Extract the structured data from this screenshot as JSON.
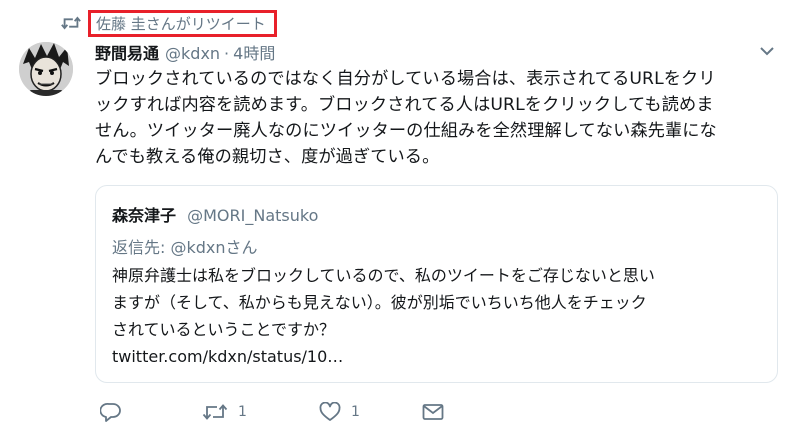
{
  "retweet": {
    "icon": "retweet-icon",
    "label": "佐藤 圭さんがリツイート",
    "highlight_color": "#e8202a"
  },
  "tweet": {
    "avatar": "avatar",
    "name": "野間易通",
    "handle": "@kdxn",
    "separator": "·",
    "time": "4時間",
    "lines": [
      "ブロックされているのではなく自分がしている場合は、表示されてるURLをクリ",
      "ックすれば内容を読めます。ブロックされてる人はURLをクリックしても読めま",
      "せん。ツイッター廃人なのにツイッターの仕組みを全然理解してない森先輩にな",
      "んでも教える俺の親切さ、度が過ぎている。"
    ]
  },
  "quote": {
    "name": "森奈津子",
    "handle": "@MORI_Natsuko",
    "reply_prefix": "返信先: ",
    "reply_mention": "@kdxn",
    "reply_suffix": "さん",
    "lines": [
      "神原弁護士は私をブロックしているので、私のツイートをご存じないと思い",
      "ますが（そして、私からも見えない）。彼が別垢でいちいち他人をチェック",
      "されているということですか？",
      "twitter.com/kdxn/status/10…"
    ]
  },
  "actions": {
    "reply_icon": "reply-icon",
    "retweet_icon": "retweet-icon",
    "retweet_count": "1",
    "like_icon": "heart-icon",
    "like_count": "1",
    "dm_icon": "envelope-icon"
  },
  "colors": {
    "text": "#14171a",
    "secondary": "#657786",
    "border": "#e1e8ed"
  }
}
